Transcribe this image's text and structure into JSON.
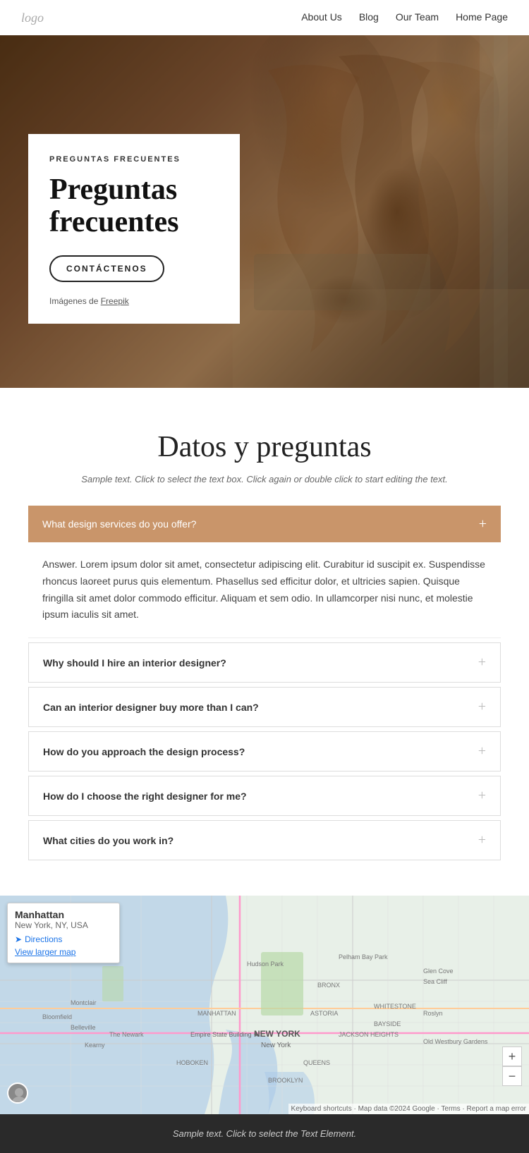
{
  "nav": {
    "logo": "logo",
    "links": [
      {
        "label": "About Us",
        "href": "#"
      },
      {
        "label": "Blog",
        "href": "#"
      },
      {
        "label": "Our Team",
        "href": "#"
      },
      {
        "label": "Home Page",
        "href": "#"
      }
    ]
  },
  "hero": {
    "eyebrow": "PREGUNTAS FRECUENTES",
    "title": "Preguntas frecuentes",
    "cta_label": "CONTÁCTENOS",
    "attribution_prefix": "Imágenes de ",
    "attribution_link": "Freepik"
  },
  "faq_section": {
    "title": "Datos y preguntas",
    "subtitle": "Sample text. Click to select the text box. Click again or double click to start editing the text.",
    "active_question": "What design services do you offer?",
    "answer": "Answer. Lorem ipsum dolor sit amet, consectetur adipiscing elit. Curabitur id suscipit ex. Suspendisse rhoncus laoreet purus quis elementum. Phasellus sed efficitur dolor, et ultricies sapien. Quisque fringilla sit amet dolor commodo efficitur. Aliquam et sem odio. In ullamcorper nisi nunc, et molestie ipsum iaculis sit amet.",
    "questions": [
      {
        "label": "Why should I hire an interior designer?"
      },
      {
        "label": "Can an interior designer buy more than I can?"
      },
      {
        "label": "How do you approach the design process?"
      },
      {
        "label": "How do I choose the right designer for me?"
      },
      {
        "label": "What cities do you work in?"
      }
    ]
  },
  "map": {
    "popup_title": "Manhattan",
    "popup_subtitle": "New York, NY, USA",
    "directions_label": "Directions",
    "larger_map_label": "View larger map",
    "attribution": "Keyboard shortcuts  ·  Map data ©2024 Google  ·  Terms  ·  Report a map error",
    "zoom_in": "+",
    "zoom_out": "−"
  },
  "footer": {
    "text": "Sample text. Click to select the Text Element."
  }
}
